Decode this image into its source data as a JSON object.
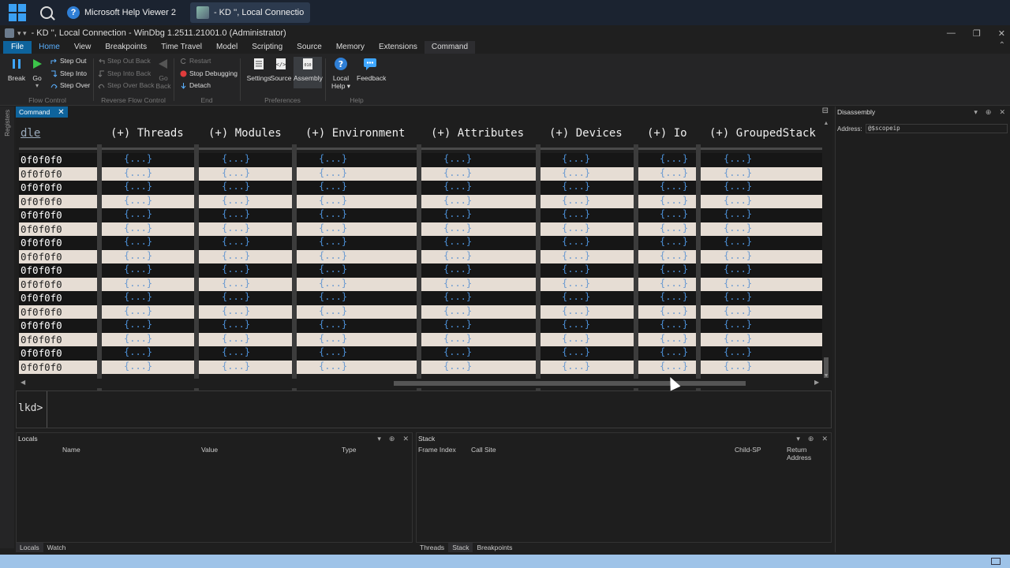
{
  "taskbar": {
    "tasks": [
      "Microsoft Help Viewer 2",
      "- KD '', Local Connectio"
    ]
  },
  "window": {
    "title": "- KD '', Local Connection - WinDbg 1.2511.21001.0 (Administrator)",
    "controls": [
      "—",
      "❐",
      "✕"
    ]
  },
  "ribbon_tabs": [
    "File",
    "Home",
    "View",
    "Breakpoints",
    "Time Travel",
    "Model",
    "Scripting",
    "Source",
    "Memory",
    "Extensions",
    "Command"
  ],
  "ribbon": {
    "flow_control": {
      "label": "Flow Control",
      "break": "Break",
      "go": "Go",
      "step_out": "Step Out",
      "step_into": "Step Into",
      "step_over": "Step Over"
    },
    "reverse_flow_control": {
      "label": "Reverse Flow Control",
      "step_out_back": "Step Out Back",
      "step_into_back": "Step Into Back",
      "step_over_back": "Step Over Back",
      "go_back_1": "Go",
      "go_back_2": "Back"
    },
    "end": {
      "label": "End",
      "restart": "Restart",
      "stop_debugging": "Stop Debugging",
      "detach": "Detach"
    },
    "preferences": {
      "label": "Preferences",
      "settings": "Settings",
      "source": "Source",
      "assembly": "Assembly"
    },
    "help": {
      "label": "Help",
      "local_help_1": "Local",
      "local_help_2": "Help ▾",
      "feedback": "Feedback"
    }
  },
  "command_pane": {
    "tab_label": "Command",
    "columns": [
      "dle",
      "(+) Threads",
      "(+) Modules",
      "(+) Environment",
      "(+) Attributes",
      "(+) Devices",
      "(+) Io",
      "(+) GroupedStack"
    ],
    "row_value": "0f0f0f0",
    "cell_value": "{...}",
    "row_count": 16,
    "prompt": "lkd>"
  },
  "locals_pane": {
    "title": "Locals",
    "columns": [
      "Name",
      "Value",
      "Type"
    ],
    "tabs": [
      "Locals",
      "Watch"
    ]
  },
  "stack_pane": {
    "title": "Stack",
    "columns": [
      "Frame Index",
      "Call Site",
      "Child-SP",
      "Return Address"
    ],
    "tabs": [
      "Threads",
      "Stack",
      "Breakpoints"
    ]
  },
  "disassembly_pane": {
    "title": "Disassembly",
    "address_label": "Address:",
    "address_value": "@$scopeip"
  },
  "pane_controls": [
    "▾",
    "⊕",
    "✕"
  ]
}
